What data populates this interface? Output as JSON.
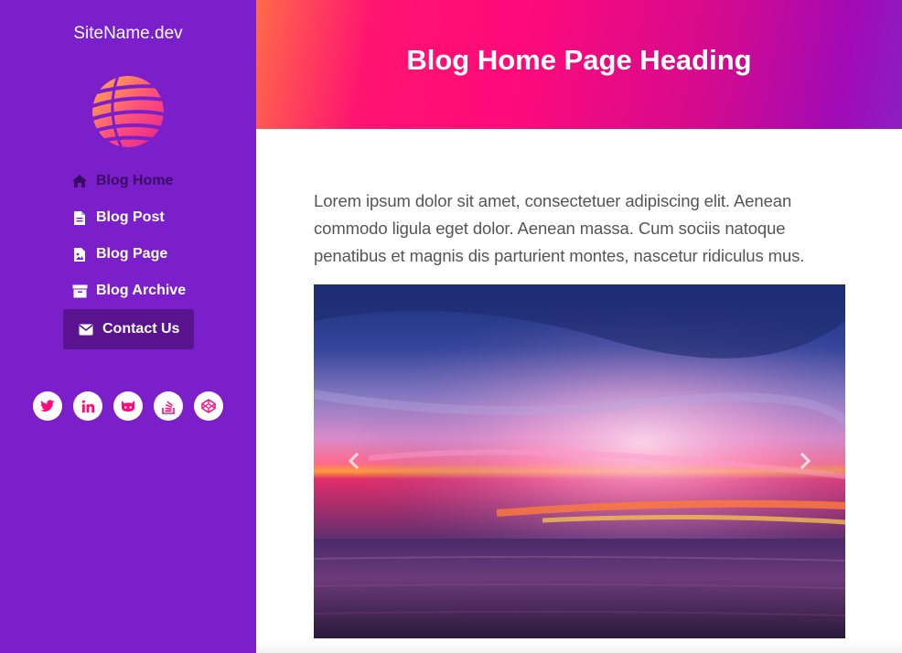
{
  "sidebar": {
    "site_name": "SiteName.dev",
    "nav": [
      {
        "label": "Blog Home",
        "icon": "home-icon"
      },
      {
        "label": "Blog Post",
        "icon": "file-icon"
      },
      {
        "label": "Blog Page",
        "icon": "file-image-icon"
      },
      {
        "label": "Blog Archive",
        "icon": "archive-icon"
      },
      {
        "label": "Contact Us",
        "icon": "envelope-icon"
      }
    ],
    "social": [
      "twitter-icon",
      "linkedin-icon",
      "github-icon",
      "stackoverflow-icon",
      "codepen-icon"
    ]
  },
  "header": {
    "title": "Blog Home Page Heading"
  },
  "main": {
    "lead": "Lorem ipsum dolor sit amet, consectetuer adipiscing elit. Aenean commodo ligula eget dolor. Aenean massa. Cum sociis natoque penatibus et magnis dis parturient montes, nascetur ridiculus mus.",
    "carousel": {
      "image": "sunset-over-sea-photo"
    }
  },
  "colors": {
    "sidebar_bg": "#7b1fcb",
    "accent": "#ff0a7a",
    "active_item_bg": "#5a138f"
  }
}
